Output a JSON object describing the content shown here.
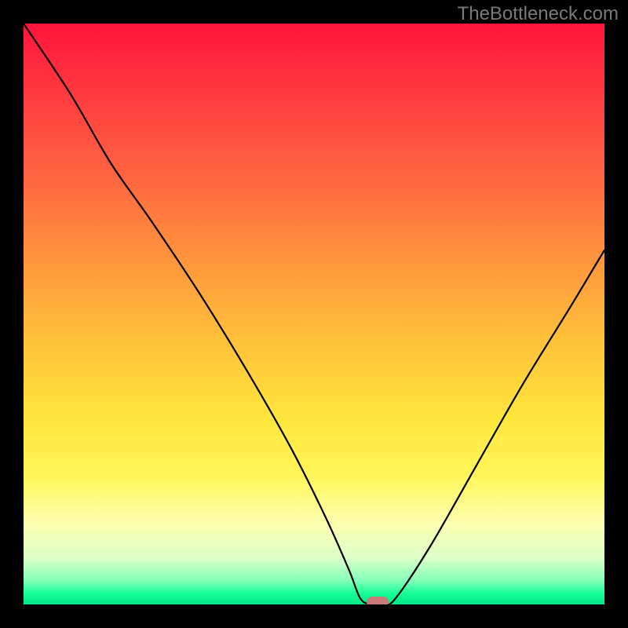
{
  "watermark": "TheBottleneck.com",
  "chart_data": {
    "type": "line",
    "title": "",
    "xlabel": "",
    "ylabel": "",
    "xlim": [
      0,
      100
    ],
    "ylim": [
      0,
      100
    ],
    "grid": false,
    "legend": false,
    "gradient": {
      "direction": "top_to_bottom",
      "stops": [
        {
          "pos": 0,
          "color": "#ff143c"
        },
        {
          "pos": 50,
          "color": "#ffc23a"
        },
        {
          "pos": 80,
          "color": "#feff80"
        },
        {
          "pos": 100,
          "color": "#00e888"
        }
      ]
    },
    "series": [
      {
        "name": "bottleneck-curve",
        "x": [
          0,
          8,
          15,
          22,
          30,
          38,
          46,
          52,
          56,
          58,
          60,
          62,
          64,
          70,
          78,
          86,
          94,
          100
        ],
        "y": [
          100,
          88,
          76,
          66,
          54,
          41,
          27,
          15,
          6,
          1,
          0,
          0,
          1,
          10,
          24,
          38,
          51,
          61
        ],
        "note": "y is bottleneck percentage (0 = no bottleneck / green band at bottom, 100 = top of plot / red)"
      }
    ],
    "marker": {
      "name": "optimal-point",
      "x": 61,
      "y": 0,
      "color": "#c77a78"
    }
  }
}
